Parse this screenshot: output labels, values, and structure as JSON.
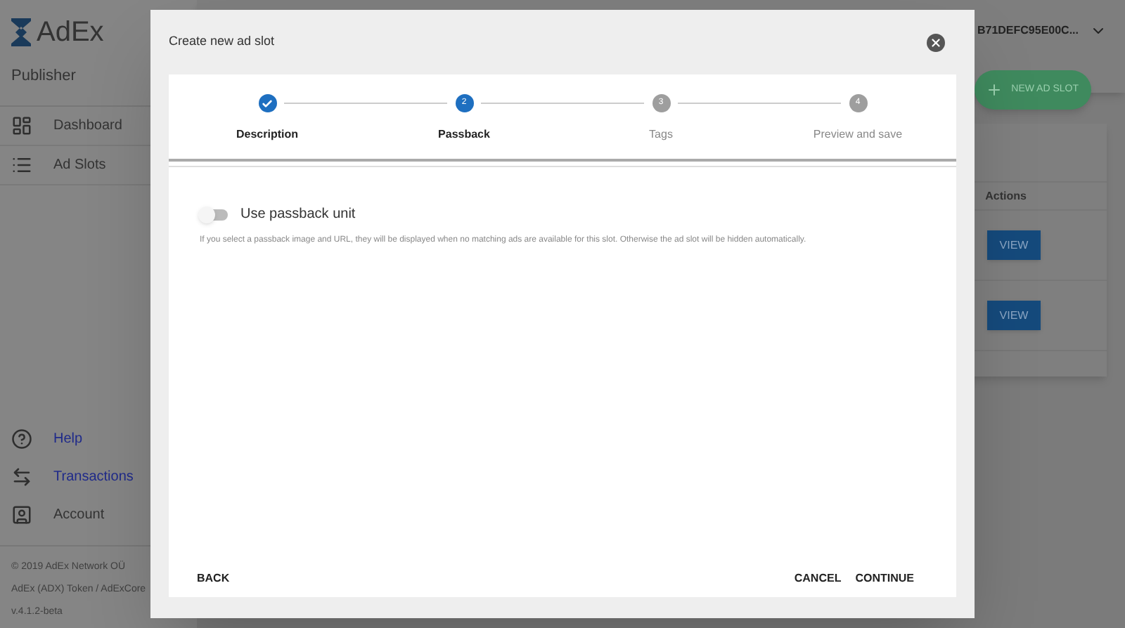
{
  "app": {
    "logo": "AdEx",
    "role": "Publisher",
    "account": "B71DEFC95E00C...",
    "nav": [
      {
        "label": "Dashboard",
        "kind": "dashboard"
      },
      {
        "label": "Ad Slots",
        "kind": "list"
      }
    ],
    "bottom_nav": [
      {
        "label": "Help",
        "kind": "help",
        "link": true
      },
      {
        "label": "Transactions",
        "kind": "swap",
        "link": true
      },
      {
        "label": "Account",
        "kind": "account",
        "link": false
      }
    ],
    "footer": [
      "© 2019  AdEx Network OÜ",
      "AdEx (ADX) Token / AdExCore",
      "v.4.1.2-beta"
    ],
    "new_button": "NEW AD SLOT",
    "table": {
      "column": "Actions",
      "rows": [
        "VIEW",
        "VIEW"
      ]
    }
  },
  "dialog": {
    "title": "Create new ad slot",
    "steps": [
      {
        "label": "Description",
        "completed": true,
        "active": false
      },
      {
        "label": "Passback",
        "marker": "2",
        "completed": false,
        "active": true
      },
      {
        "label": "Tags",
        "marker": "3",
        "completed": false,
        "active": false
      },
      {
        "label": "Preview and save",
        "marker": "4",
        "completed": false,
        "active": false
      }
    ],
    "toggle": {
      "label": "Use passback unit",
      "on": false
    },
    "help": "If you select a passback image and URL, they will be displayed when no matching ads are available for this slot. Otherwise the ad slot will be hidden automatically.",
    "back": "BACK",
    "cancel": "CANCEL",
    "continue": "CONTINUE"
  }
}
